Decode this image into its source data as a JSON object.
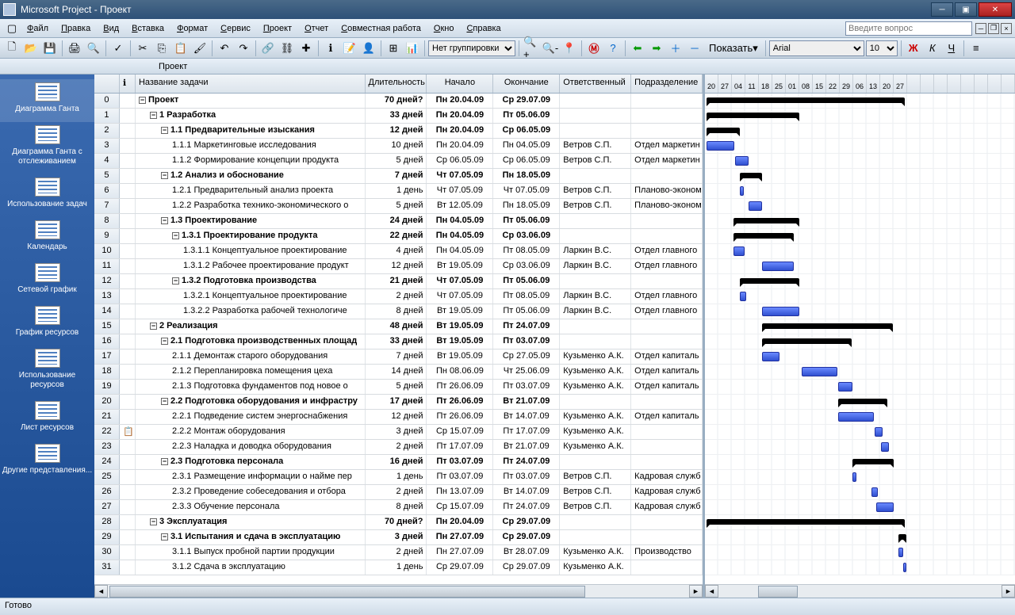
{
  "window": {
    "title": "Microsoft Project - Проект"
  },
  "menu": {
    "items": [
      "Файл",
      "Правка",
      "Вид",
      "Вставка",
      "Формат",
      "Сервис",
      "Проект",
      "Отчет",
      "Совместная работа",
      "Окно",
      "Справка"
    ],
    "question_placeholder": "Введите вопрос"
  },
  "toolbar": {
    "grouping": "Нет группировки",
    "show": "Показать",
    "font": "Arial",
    "fontsize": "10"
  },
  "docrow": {
    "title": "Проект"
  },
  "sidebar": {
    "items": [
      {
        "label": "Диаграмма Ганта",
        "active": true
      },
      {
        "label": "Диаграмма Ганта с отслеживанием"
      },
      {
        "label": "Использование задач"
      },
      {
        "label": "Календарь"
      },
      {
        "label": "Сетевой график"
      },
      {
        "label": "График ресурсов"
      },
      {
        "label": "Использование ресурсов"
      },
      {
        "label": "Лист ресурсов"
      },
      {
        "label": "Другие представления..."
      }
    ]
  },
  "columns": {
    "info": "",
    "name": "Название задачи",
    "duration": "Длительность",
    "start": "Начало",
    "end": "Окончание",
    "resp": "Ответственный",
    "dept": "Подразделение"
  },
  "timeline": [
    "20",
    "27",
    "04",
    "11",
    "18",
    "25",
    "01",
    "08",
    "15",
    "22",
    "29",
    "06",
    "13",
    "20",
    "27"
  ],
  "tasks": [
    {
      "row": 0,
      "level": 0,
      "summary": true,
      "name": "Проект",
      "dur": "70 дней?",
      "start": "Пн 20.04.09",
      "end": "Ср 29.07.09",
      "resp": "",
      "dept": "",
      "gx": 2,
      "gw": 250
    },
    {
      "row": 1,
      "level": 1,
      "summary": true,
      "name": "1 Разработка",
      "dur": "33 дней",
      "start": "Пн 20.04.09",
      "end": "Пт 05.06.09",
      "resp": "",
      "dept": "",
      "gx": 2,
      "gw": 117
    },
    {
      "row": 2,
      "level": 2,
      "summary": true,
      "name": "1.1 Предварительные изыскания",
      "dur": "12 дней",
      "start": "Пн 20.04.09",
      "end": "Ср 06.05.09",
      "resp": "",
      "dept": "",
      "gx": 2,
      "gw": 42
    },
    {
      "row": 3,
      "level": 3,
      "name": "1.1.1 Маркетинговые исследования",
      "dur": "10 дней",
      "start": "Пн 20.04.09",
      "end": "Пн 04.05.09",
      "resp": "Ветров С.П.",
      "dept": "Отдел маркетин",
      "gx": 2,
      "gw": 35
    },
    {
      "row": 4,
      "level": 3,
      "name": "1.1.2 Формирование концепции продукта",
      "dur": "5 дней",
      "start": "Ср 06.05.09",
      "end": "Ср 06.05.09",
      "resp": "Ветров С.П.",
      "dept": "Отдел маркетин",
      "gx": 38,
      "gw": 17
    },
    {
      "row": 5,
      "level": 2,
      "summary": true,
      "name": "1.2 Анализ и обоснование",
      "dur": "7 дней",
      "start": "Чт 07.05.09",
      "end": "Пн 18.05.09",
      "resp": "",
      "dept": "",
      "gx": 44,
      "gw": 28
    },
    {
      "row": 6,
      "level": 3,
      "name": "1.2.1 Предварительный анализ проекта",
      "dur": "1 день",
      "start": "Чт 07.05.09",
      "end": "Чт 07.05.09",
      "resp": "Ветров С.П.",
      "dept": "Планово-эконом",
      "gx": 44,
      "gw": 5
    },
    {
      "row": 7,
      "level": 3,
      "name": "1.2.2 Разработка технико-экономического о",
      "dur": "5 дней",
      "start": "Вт 12.05.09",
      "end": "Пн 18.05.09",
      "resp": "Ветров С.П.",
      "dept": "Планово-эконом",
      "gx": 55,
      "gw": 17
    },
    {
      "row": 8,
      "level": 2,
      "summary": true,
      "name": "1.3 Проектирование",
      "dur": "24 дней",
      "start": "Пн 04.05.09",
      "end": "Пт 05.06.09",
      "resp": "",
      "dept": "",
      "gx": 36,
      "gw": 83
    },
    {
      "row": 9,
      "level": 3,
      "summary": true,
      "name": "1.3.1 Проектирование продукта",
      "dur": "22 дней",
      "start": "Пн 04.05.09",
      "end": "Ср 03.06.09",
      "resp": "",
      "dept": "",
      "gx": 36,
      "gw": 76
    },
    {
      "row": 10,
      "level": 4,
      "name": "1.3.1.1 Концептуальное проектирование",
      "dur": "4 дней",
      "start": "Пн 04.05.09",
      "end": "Пт 08.05.09",
      "resp": "Ларкин В.С.",
      "dept": "Отдел главного",
      "gx": 36,
      "gw": 14
    },
    {
      "row": 11,
      "level": 4,
      "name": "1.3.1.2 Рабочее проектирование продукт",
      "dur": "12 дней",
      "start": "Вт 19.05.09",
      "end": "Ср 03.06.09",
      "resp": "Ларкин В.С.",
      "dept": "Отдел главного",
      "gx": 72,
      "gw": 40
    },
    {
      "row": 12,
      "level": 3,
      "summary": true,
      "name": "1.3.2 Подготовка производства",
      "dur": "21 дней",
      "start": "Чт 07.05.09",
      "end": "Пт 05.06.09",
      "resp": "",
      "dept": "",
      "gx": 44,
      "gw": 75
    },
    {
      "row": 13,
      "level": 4,
      "name": "1.3.2.1 Концептуальное проектирование",
      "dur": "2 дней",
      "start": "Чт 07.05.09",
      "end": "Пт 08.05.09",
      "resp": "Ларкин В.С.",
      "dept": "Отдел главного",
      "gx": 44,
      "gw": 8
    },
    {
      "row": 14,
      "level": 4,
      "name": "1.3.2.2 Разработка рабочей технологиче",
      "dur": "8 дней",
      "start": "Вт 19.05.09",
      "end": "Пт 05.06.09",
      "resp": "Ларкин В.С.",
      "dept": "Отдел главного",
      "gx": 72,
      "gw": 47
    },
    {
      "row": 15,
      "level": 1,
      "summary": true,
      "name": "2 Реализация",
      "dur": "48 дней",
      "start": "Вт 19.05.09",
      "end": "Пт 24.07.09",
      "resp": "",
      "dept": "",
      "gx": 72,
      "gw": 165
    },
    {
      "row": 16,
      "level": 2,
      "summary": true,
      "name": "2.1 Подготовка производственных площад",
      "dur": "33 дней",
      "start": "Вт 19.05.09",
      "end": "Пт 03.07.09",
      "resp": "",
      "dept": "",
      "gx": 72,
      "gw": 113
    },
    {
      "row": 17,
      "level": 3,
      "name": "2.1.1 Демонтаж старого оборудования",
      "dur": "7 дней",
      "start": "Вт 19.05.09",
      "end": "Ср 27.05.09",
      "resp": "Кузьменко А.К.",
      "dept": "Отдел капиталь",
      "gx": 72,
      "gw": 22
    },
    {
      "row": 18,
      "level": 3,
      "name": "2.1.2 Перепланировка помещения цеха",
      "dur": "14 дней",
      "start": "Пн 08.06.09",
      "end": "Чт 25.06.09",
      "resp": "Кузьменко А.К.",
      "dept": "Отдел капиталь",
      "gx": 122,
      "gw": 45
    },
    {
      "row": 19,
      "level": 3,
      "name": "2.1.3 Подготовка фундаментов под новое о",
      "dur": "5 дней",
      "start": "Пт 26.06.09",
      "end": "Пт 03.07.09",
      "resp": "Кузьменко А.К.",
      "dept": "Отдел капиталь",
      "gx": 168,
      "gw": 18
    },
    {
      "row": 20,
      "level": 2,
      "summary": true,
      "name": "2.2 Подготовка оборудования и инфрастру",
      "dur": "17 дней",
      "start": "Пт 26.06.09",
      "end": "Вт 21.07.09",
      "resp": "",
      "dept": "",
      "gx": 168,
      "gw": 62
    },
    {
      "row": 21,
      "level": 3,
      "name": "2.2.1 Подведение систем энергоснабжения",
      "dur": "12 дней",
      "start": "Пт 26.06.09",
      "end": "Вт 14.07.09",
      "resp": "Кузьменко А.К.",
      "dept": "Отдел капиталь",
      "gx": 168,
      "gw": 45
    },
    {
      "row": 22,
      "level": 3,
      "name": "2.2.2 Монтаж оборудования",
      "dur": "3 дней",
      "start": "Ср 15.07.09",
      "end": "Пт 17.07.09",
      "resp": "Кузьменко А.К.",
      "dept": "",
      "gx": 214,
      "gw": 10,
      "icon": true
    },
    {
      "row": 23,
      "level": 3,
      "name": "2.2.3 Наладка и доводка оборудования",
      "dur": "2 дней",
      "start": "Пт 17.07.09",
      "end": "Вт 21.07.09",
      "resp": "Кузьменко А.К.",
      "dept": "",
      "gx": 222,
      "gw": 10
    },
    {
      "row": 24,
      "level": 2,
      "summary": true,
      "name": "2.3 Подготовка персонала",
      "dur": "16 дней",
      "start": "Пт 03.07.09",
      "end": "Пт 24.07.09",
      "resp": "",
      "dept": "",
      "gx": 186,
      "gw": 52
    },
    {
      "row": 25,
      "level": 3,
      "name": "2.3.1 Размещение информации о найме пер",
      "dur": "1 день",
      "start": "Пт 03.07.09",
      "end": "Пт 03.07.09",
      "resp": "Ветров С.П.",
      "dept": "Кадровая служб",
      "gx": 186,
      "gw": 5
    },
    {
      "row": 26,
      "level": 3,
      "name": "2.3.2 Проведение собеседования и отбора",
      "dur": "2 дней",
      "start": "Пн 13.07.09",
      "end": "Вт 14.07.09",
      "resp": "Ветров С.П.",
      "dept": "Кадровая служб",
      "gx": 210,
      "gw": 8
    },
    {
      "row": 27,
      "level": 3,
      "name": "2.3.3 Обучение персонала",
      "dur": "8 дней",
      "start": "Ср 15.07.09",
      "end": "Пт 24.07.09",
      "resp": "Ветров С.П.",
      "dept": "Кадровая служб",
      "gx": 216,
      "gw": 22
    },
    {
      "row": 28,
      "level": 1,
      "summary": true,
      "name": "3 Эксплуатация",
      "dur": "70 дней?",
      "start": "Пн 20.04.09",
      "end": "Ср 29.07.09",
      "resp": "",
      "dept": "",
      "gx": 2,
      "gw": 250
    },
    {
      "row": 29,
      "level": 2,
      "summary": true,
      "name": "3.1 Испытания и сдача в эксплуатацию",
      "dur": "3 дней",
      "start": "Пн 27.07.09",
      "end": "Ср 29.07.09",
      "resp": "",
      "dept": "",
      "gx": 244,
      "gw": 10
    },
    {
      "row": 30,
      "level": 3,
      "name": "3.1.1 Выпуск пробной партии продукции",
      "dur": "2 дней",
      "start": "Пн 27.07.09",
      "end": "Вт 28.07.09",
      "resp": "Кузьменко А.К.",
      "dept": "Производство",
      "gx": 244,
      "gw": 6
    },
    {
      "row": 31,
      "level": 3,
      "name": "3.1.2 Сдача в эксплуатацию",
      "dur": "1 день",
      "start": "Ср 29.07.09",
      "end": "Ср 29.07.09",
      "resp": "Кузьменко А.К.",
      "dept": "",
      "gx": 250,
      "gw": 4
    }
  ],
  "status": {
    "text": "Готово"
  }
}
